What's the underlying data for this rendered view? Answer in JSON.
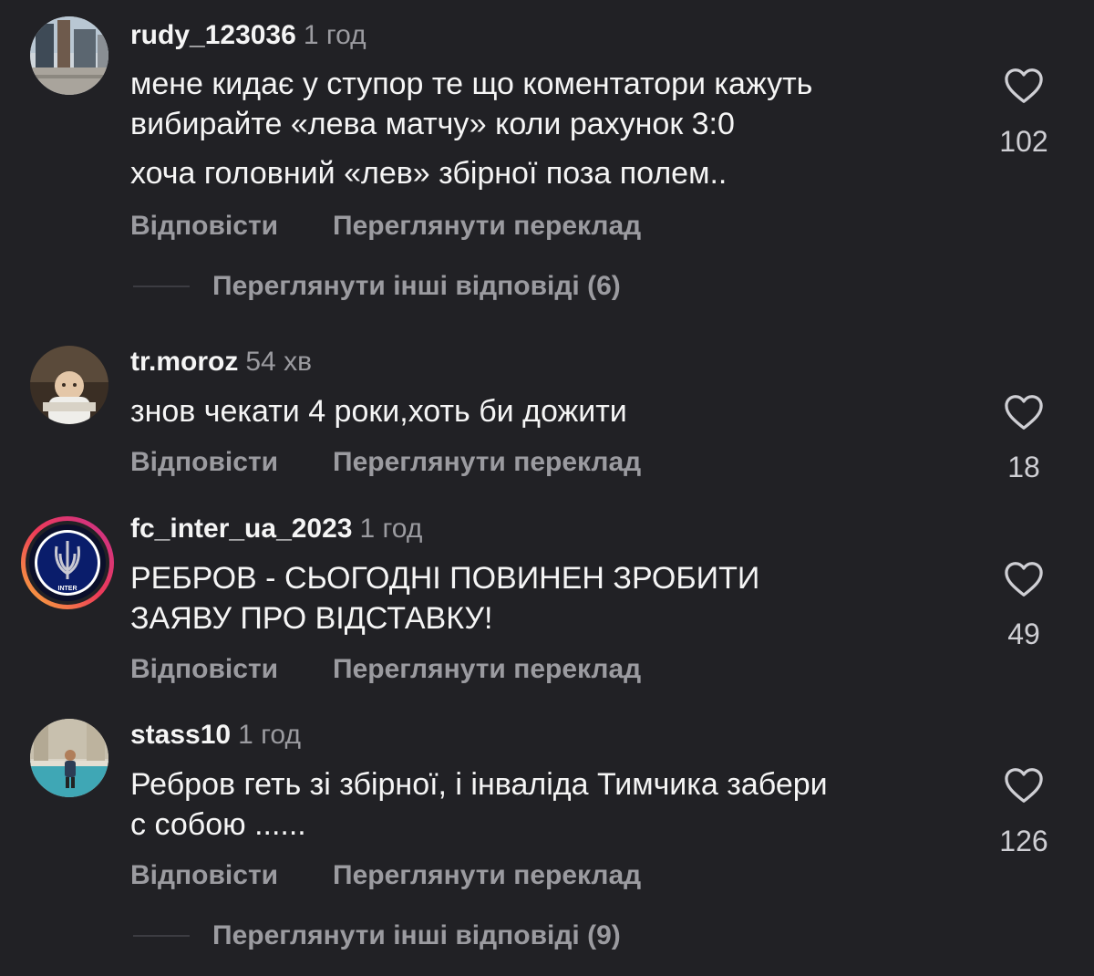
{
  "comments": [
    {
      "username": "rudy_123036",
      "time": "1 год",
      "text": "мене кидає у ступор те що коментатори кажуть\nвибирайте «лева матчу» коли рахунок 3:0",
      "text2": "хоча головний «лев» збірної  поза полем..",
      "likes": "102",
      "reply_label": "Відповісти",
      "translate_label": "Переглянути переклад",
      "more_replies": "Переглянути інші відповіді (6)"
    },
    {
      "username": "tr.moroz",
      "time": "54 хв",
      "text": "знов чекати 4 роки,хоть би дожити",
      "likes": "18",
      "reply_label": "Відповісти",
      "translate_label": "Переглянути переклад"
    },
    {
      "username": "fc_inter_ua_2023",
      "time": "1 год",
      "text": "РЕБРОВ - СЬОГОДНІ ПОВИНЕН ЗРОБИТИ\nЗАЯВУ ПРО ВІДСТАВКУ!",
      "likes": "49",
      "reply_label": "Відповісти",
      "translate_label": "Переглянути переклад",
      "avatar_text": "INTER"
    },
    {
      "username": "stass10",
      "time": "1 год",
      "text": "Ребров геть зі збірної, і інваліда Тимчика забери\nс собою ......",
      "likes": "126",
      "reply_label": "Відповісти",
      "translate_label": "Переглянути переклад",
      "more_replies": "Переглянути інші відповіді (9)"
    }
  ],
  "icons": {
    "like": "heart-outline-icon"
  },
  "colors": {
    "background": "#212125",
    "primary_text": "#f5f5f5",
    "secondary_text": "#9b9ba0",
    "story_ring_start": "#f9b43a",
    "story_ring_end": "#c7308e"
  }
}
